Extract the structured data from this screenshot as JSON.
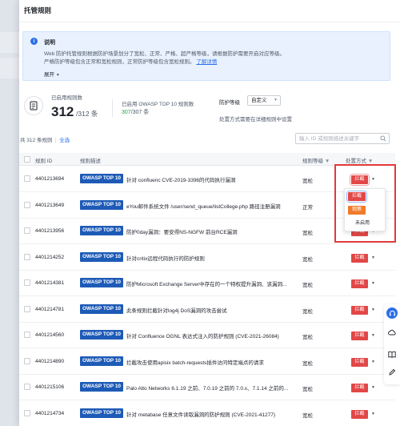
{
  "drawer": {
    "title": "托管规则"
  },
  "info": {
    "title": "说明",
    "line1": "Web 防护托管规则根据防护场景划分了宽松、正常、严格、超严格等级，请根据防护需要开启对应等级。",
    "line2_prefix": "严格防护等级包含正常和宽松规则，正常防护等级包含宽松规则。",
    "line2_link": "了解详情",
    "expand": "展开"
  },
  "stats": {
    "enabled_label": "已启用规则数",
    "enabled_count": "312",
    "enabled_total": "/312 条",
    "owasp_label": "已启用 OWASP TOP 10 规则数",
    "owasp_count": "307",
    "owasp_total": "/307 条",
    "level_label": "防护等级",
    "level_value": "自定义",
    "level_hint": "处置方式需要在详细规则中设置"
  },
  "filter": {
    "total": "共 312 条规则",
    "all_label": "全选",
    "search_placeholder": "输入 ID 或规则描述关键字"
  },
  "table": {
    "columns": [
      "规则 ID",
      "规则描述",
      "规则等级",
      "处置方式"
    ],
    "rows": [
      {
        "id": "4401213694",
        "tag": "OWASP TOP 10",
        "desc": "针对 confluenc CVE-2019-3396的代码执行漏洞",
        "level": "宽松",
        "action": "拦截"
      },
      {
        "id": "4401213649",
        "tag": "OWASP TOP 10",
        "desc": "eYou邮件系统文件 /user/send_queue/listCollege.php 路径注册漏洞",
        "level": "正常",
        "action": "拦截"
      },
      {
        "id": "4401213956",
        "tag": "OWASP TOP 10",
        "desc": "防护0day漏洞：要安得NS-NGFW 前台RCE漏洞",
        "level": "宽松",
        "action": "拦截"
      },
      {
        "id": "4401214252",
        "tag": "OWASP TOP 10",
        "desc": "针对critix远程代码执行的防护规则",
        "level": "宽松",
        "action": "拦截"
      },
      {
        "id": "4401214381",
        "tag": "OWASP TOP 10",
        "desc": "防护Microsoft Exchange Server中存在的一个特权提升漏洞、该漏洞...",
        "level": "宽松",
        "action": "拦截"
      },
      {
        "id": "4401214781",
        "tag": "OWASP TOP 10",
        "desc": "此条规则拦截针对log4j DoS漏洞的攻击尝试",
        "level": "宽松",
        "action": "拦截"
      },
      {
        "id": "4401214560",
        "tag": "OWASP TOP 10",
        "desc": "针对 Confluence OGNL 表达式注入的防护规则 (CVE-2021-26084)",
        "level": "宽松",
        "action": "拦截"
      },
      {
        "id": "4401214890",
        "tag": "OWASP TOP 10",
        "desc": "拦截攻击使用apisix batch-requests插件访问特定端点的请求",
        "level": "宽松",
        "action": "拦截"
      },
      {
        "id": "4401215106",
        "tag": "OWASP TOP 10",
        "desc": "Palo Alto Networks 6.1.19 之前、7.0.19 之前的 7.0.x、7.1.14 之前的...",
        "level": "宽松",
        "action": "拦截"
      },
      {
        "id": "4401214734",
        "tag": "OWASP TOP 10",
        "desc": "针对 metabase 任意文件读取漏洞的防护规则 (CVE-2021-41277)",
        "level": "宽松",
        "action": "拦截"
      }
    ]
  },
  "dropdown": {
    "options": [
      "拦截",
      "观察",
      "未启用"
    ],
    "colors": {
      "block": "#e24747",
      "observe": "#f07b2a"
    }
  },
  "colors": {
    "accent": "#2c6fe8",
    "tag_bg": "#1e5bb7",
    "highlight": "#e03a3a"
  }
}
